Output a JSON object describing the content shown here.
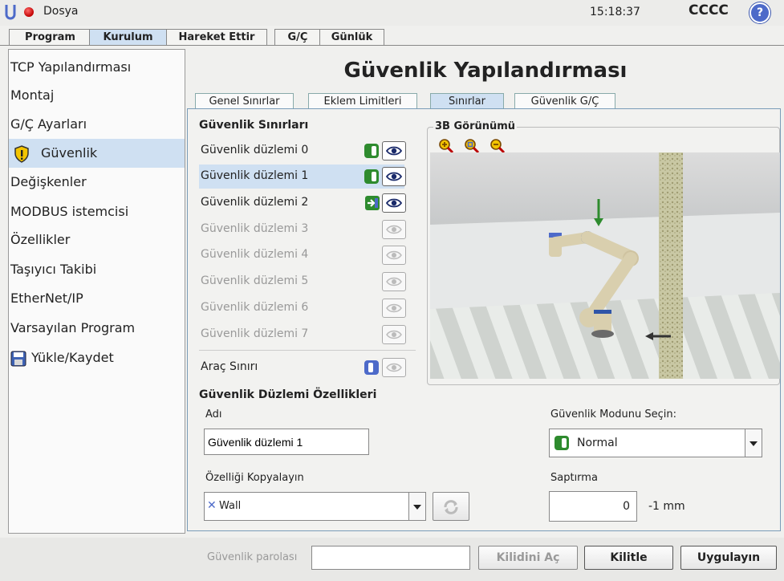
{
  "topbar": {
    "filename": "Dosya",
    "clock": "15:18:37",
    "robot_name": "CCCC",
    "help_glyph": "?"
  },
  "main_tabs": [
    {
      "label": "Program",
      "active": false
    },
    {
      "label": "Kurulum",
      "active": true
    },
    {
      "label": "Hareket Ettir",
      "active": false
    },
    {
      "label": "G/Ç",
      "active": false
    },
    {
      "label": "Günlük",
      "active": false
    }
  ],
  "left_nav": [
    {
      "label": "TCP Yapılandırması"
    },
    {
      "label": "Montaj"
    },
    {
      "label": "G/Ç Ayarları"
    },
    {
      "label": "Güvenlik",
      "selected": true,
      "icon": "shield-warning-icon"
    },
    {
      "label": "Değişkenler"
    },
    {
      "label": "MODBUS istemcisi"
    },
    {
      "label": "Özellikler"
    },
    {
      "label": "Taşıyıcı Takibi"
    },
    {
      "label": "EtherNet/IP"
    },
    {
      "label": "Varsayılan Program"
    },
    {
      "label": "Yükle/Kaydet",
      "icon": "floppy-disk-icon"
    }
  ],
  "page_title": "Güvenlik Yapılandırması",
  "sub_tabs": [
    {
      "label": "Genel Sınırlar"
    },
    {
      "label": "Eklem Limitleri"
    },
    {
      "label": "Sınırlar",
      "active": true
    },
    {
      "label": "Güvenlik G/Ç"
    }
  ],
  "limits": {
    "heading": "Güvenlik Sınırları",
    "planes": [
      {
        "label": "Güvenlik düzlemi 0",
        "enabled": true,
        "mode": "normal"
      },
      {
        "label": "Güvenlik düzlemi 1",
        "enabled": true,
        "mode": "normal",
        "selected": true
      },
      {
        "label": "Güvenlik düzlemi 2",
        "enabled": true,
        "mode": "trigger"
      },
      {
        "label": "Güvenlik düzlemi 3",
        "enabled": false
      },
      {
        "label": "Güvenlik düzlemi 4",
        "enabled": false
      },
      {
        "label": "Güvenlik düzlemi 5",
        "enabled": false
      },
      {
        "label": "Güvenlik düzlemi 6",
        "enabled": false
      },
      {
        "label": "Güvenlik düzlemi 7",
        "enabled": false
      }
    ],
    "tool_limit_label": "Araç Sınırı"
  },
  "view3d": {
    "heading": "3B Görünümü",
    "zoom_icons": [
      "zoom-in-icon",
      "zoom-fit-icon",
      "zoom-out-icon"
    ]
  },
  "properties": {
    "heading": "Güvenlik Düzlemi Özellikleri",
    "name_label": "Adı",
    "name_value": "Güvenlik düzlemi 1",
    "copy_label": "Özelliği Kopyalayın",
    "copy_value": "Wall",
    "mode_label": "Güvenlik Modunu Seçin:",
    "mode_value": "Normal",
    "displacement_label": "Saptırma",
    "displacement_value": "0",
    "displacement_unit": "-1 mm"
  },
  "bottom": {
    "password_placeholder": "Güvenlik parolası",
    "unlock_label": "Kilidini Aç",
    "lock_label": "Kilitle",
    "apply_label": "Uygulayın"
  },
  "colors": {
    "accent_blue": "#cfe0f2",
    "toggle_green": "#2e8b2e",
    "toggle_blue": "#4d6ac9",
    "help_blue": "#4d6ac9"
  }
}
